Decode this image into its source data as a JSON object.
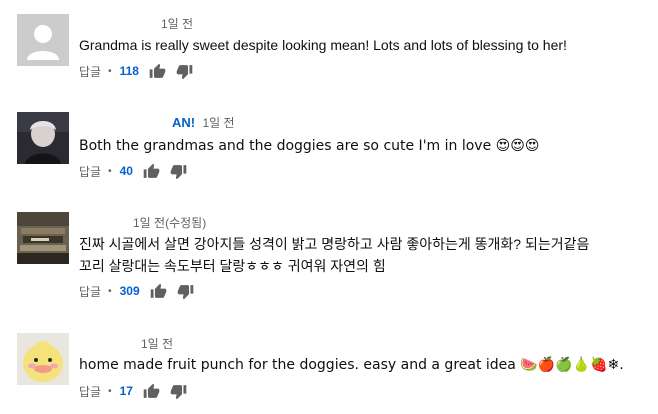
{
  "comments": [
    {
      "author": "",
      "time": "1일 전",
      "text": "Grandma is really sweet despite looking mean! Lots and lots of blessing to her!",
      "reply": "답글",
      "likes": "118",
      "avatar": "default-user-avatar"
    },
    {
      "author": "AN!",
      "time": "1일 전",
      "text": "Both the grandmas and the doggies are so cute I'm in love 😍😍😍",
      "reply": "답글",
      "likes": "40",
      "avatar": "person-photo-avatar"
    },
    {
      "author": "",
      "time": "1일 전(수정됨)",
      "text": "진짜 시골에서 살면 강아지들 성격이 밝고 명랑하고 사람 좋아하는게 똥개화? 되는거같음",
      "text2": "꼬리 살랑대는 속도부터 달랑ㅎㅎㅎ 귀여워 자연의 힘",
      "reply": "답글",
      "likes": "309",
      "avatar": "books-photo-avatar"
    },
    {
      "author": "",
      "time": "1일 전",
      "text": "home made fruit punch for the doggies. easy and a great idea 🍉🍎🍏🍐🍓❄.",
      "reply": "답글",
      "likes": "17",
      "avatar": "duck-plush-avatar"
    }
  ],
  "colors": {
    "likes": "#065fd4",
    "muted": "#606060",
    "text": "#0f0f0f"
  }
}
